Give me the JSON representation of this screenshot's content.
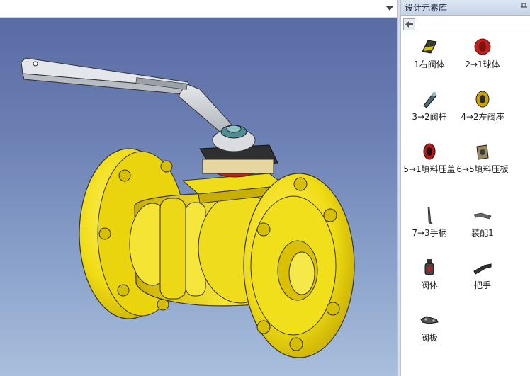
{
  "panel": {
    "title": "设计元素库",
    "pin_icon": "pin-icon",
    "back_icon": "back-arrow-icon",
    "items": [
      {
        "label": "1右阀体",
        "icon": "valve-body-right-thumb"
      },
      {
        "label": "2→1球体",
        "icon": "ball-thumb"
      },
      {
        "label": "3→2阀杆",
        "icon": "stem-thumb"
      },
      {
        "label": "4→2左阀座",
        "icon": "left-seat-thumb"
      },
      {
        "label": "5→1填料压盖",
        "icon": "gland-thumb"
      },
      {
        "label": "6→5填料压板",
        "icon": "gland-plate-thumb"
      },
      {
        "label": "7→3手柄",
        "icon": "handle-thumb"
      },
      {
        "label": "装配1",
        "icon": "assembly-thumb"
      },
      {
        "label": "阀体",
        "icon": "valve-body-thumb"
      },
      {
        "label": "把手",
        "icon": "grip-thumb"
      },
      {
        "label": "阀板",
        "icon": "valve-plate-thumb"
      }
    ]
  },
  "viewport": {
    "model": "ball-valve-3d-model",
    "dropdown_icon": "chevron-down-icon",
    "colors": {
      "body": "#f3e21a",
      "body_shade": "#c9b000",
      "handle": "#cfd3d6",
      "gland": "#2a2a2a",
      "seal": "#c0201c"
    }
  }
}
